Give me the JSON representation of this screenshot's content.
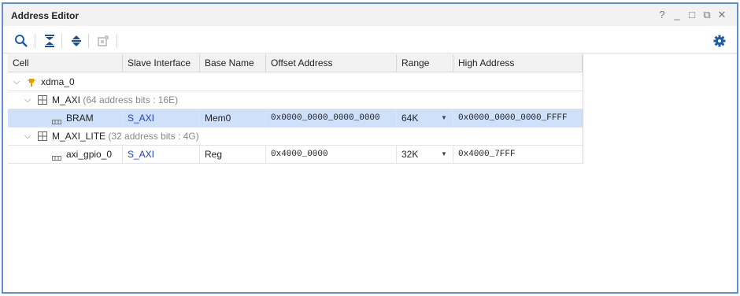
{
  "window": {
    "title": "Address Editor"
  },
  "window_controls": {
    "help": "?",
    "minimize": "_",
    "maximize": "□",
    "restore": "⧉",
    "close": "✕"
  },
  "toolbar": {
    "search_icon": "search-icon",
    "collapse_icon": "collapse-all-icon",
    "expand_icon": "expand-all-icon",
    "assign_icon": "auto-assign-icon",
    "settings_icon": "gear-icon"
  },
  "columns": [
    "Cell",
    "Slave Interface",
    "Base Name",
    "Offset Address",
    "Range",
    "High Address"
  ],
  "tree": {
    "root": {
      "label": "xdma_0"
    },
    "groups": [
      {
        "label": "M_AXI",
        "note": "(64 address bits : 16E)",
        "rows": [
          {
            "cell": "BRAM",
            "slave_interface": "S_AXI",
            "base_name": "Mem0",
            "offset": "0x0000_0000_0000_0000",
            "range": "64K",
            "high": "0x0000_0000_0000_FFFF",
            "selected": true
          }
        ]
      },
      {
        "label": "M_AXI_LITE",
        "note": "(32 address bits : 4G)",
        "rows": [
          {
            "cell": "axi_gpio_0",
            "slave_interface": "S_AXI",
            "base_name": "Reg",
            "offset": "0x4000_0000",
            "range": "32K",
            "high": "0x4000_7FFF",
            "selected": false
          }
        ]
      }
    ]
  },
  "colors": {
    "border": "#5c8fd6",
    "selection": "#cfe0fb",
    "link": "#1a3fc4"
  }
}
